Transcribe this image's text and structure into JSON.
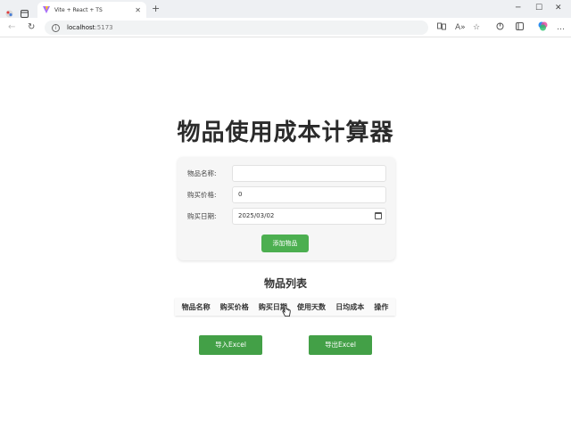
{
  "browser": {
    "tab_title": "Vite + React + TS",
    "tab_close": "✕",
    "new_tab": "+",
    "url_host": "localhost",
    "url_port": ":5173",
    "info_glyph": "i",
    "back_glyph": "←",
    "refresh_glyph": "↻",
    "minimize_glyph": "─",
    "maximize_glyph": "☐",
    "close_glyph": "✕",
    "read_aloud_glyph": "A»",
    "favorite_glyph": "☆",
    "more_glyph": "…"
  },
  "page": {
    "title": "物品使用成本计算器",
    "form": {
      "name_label": "物品名称:",
      "name_value": "",
      "price_label": "购买价格:",
      "price_value": "0",
      "date_label": "购买日期:",
      "date_value": "2025/03/02",
      "add_button": "添加物品"
    },
    "list": {
      "title": "物品列表",
      "headers": [
        "物品名称",
        "购买价格",
        "购买日期",
        "使用天数",
        "日均成本",
        "操作"
      ]
    },
    "import_button": "导入Excel",
    "export_button": "导出Excel"
  },
  "colors": {
    "accent": "#4caf50",
    "excel_button": "#43a047"
  }
}
